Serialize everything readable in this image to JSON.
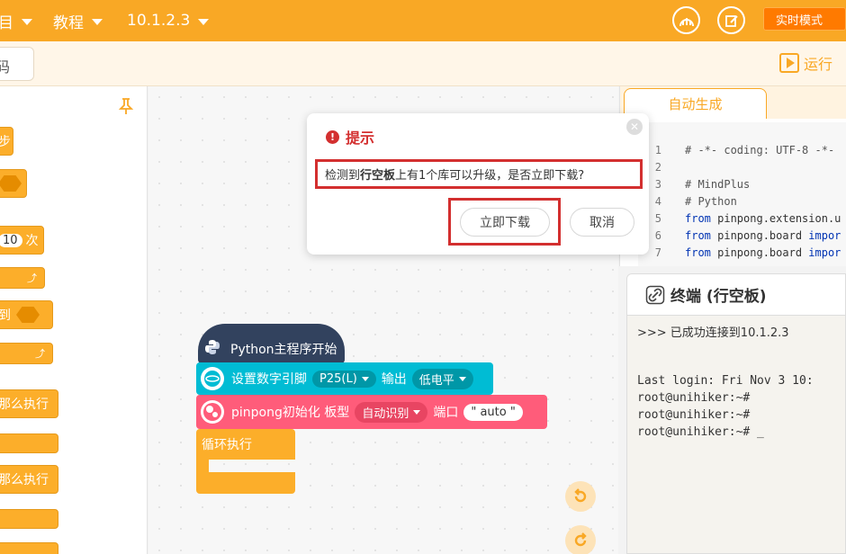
{
  "topbar": {
    "project_menu": "目",
    "tutorial_menu": "教程",
    "device_ip": "10.1.2.3",
    "mode_button": "实时模式"
  },
  "toolbar": {
    "search_text": "码",
    "run_label": "运行"
  },
  "palette": {
    "blocks": [
      {
        "label": "步"
      },
      {
        "label": ""
      },
      {
        "num": "10",
        "label": "次"
      },
      {
        "label": ""
      },
      {
        "label": "到"
      },
      {
        "label": ""
      },
      {
        "label": "那么执行"
      },
      {
        "label": ""
      },
      {
        "label": "那么执行"
      },
      {
        "label": ""
      }
    ]
  },
  "workspace": {
    "main_block": "Python主程序开始",
    "pin_block": {
      "prefix": "设置数字引脚",
      "pin": "P25(L)",
      "middle": "输出",
      "level": "低电平"
    },
    "pinpong_block": {
      "prefix": "pinpong初始化 板型",
      "board": "自动识别",
      "middle": "端口",
      "port": "\" auto \""
    },
    "loop_block": "循环执行"
  },
  "code_panel": {
    "tab_label": "自动生成",
    "lines": [
      {
        "n": "1",
        "text": "#  -*- coding: UTF-8 -*-"
      },
      {
        "n": "2",
        "text": ""
      },
      {
        "n": "3",
        "text": "# MindPlus"
      },
      {
        "n": "4",
        "text": "# Python"
      },
      {
        "n": "5",
        "kw": "from",
        "rest": " pinpong.extension.u"
      },
      {
        "n": "6",
        "kw": "from",
        "rest": " pinpong.board ",
        "kw2": "impor"
      },
      {
        "n": "7",
        "kw": "from",
        "rest": " pinpong.board ",
        "kw2": "impor"
      }
    ]
  },
  "terminal": {
    "title": "终端 (行空板)",
    "lines": [
      ">>> 已成功连接到10.1.2.3",
      "",
      "",
      "Last login: Fri Nov  3 10:",
      "root@unihiker:~#",
      "root@unihiker:~#",
      "root@unihiker:~# _"
    ]
  },
  "dialog": {
    "title": "提示",
    "message_prefix": "检测到",
    "message_bold": "行空板",
    "message_suffix": "上有1个库可以升级，是否立即下载?",
    "confirm": "立即下载",
    "cancel": "取消"
  },
  "colors": {
    "topbar": "#f9a825",
    "mode_button": "#ff7a00",
    "alert": "#d32f2f",
    "python_block": "#32425e",
    "pin_block": "#00bcd4",
    "pinpong_block": "#ff5c7a",
    "loop_block": "#fcae2a"
  }
}
